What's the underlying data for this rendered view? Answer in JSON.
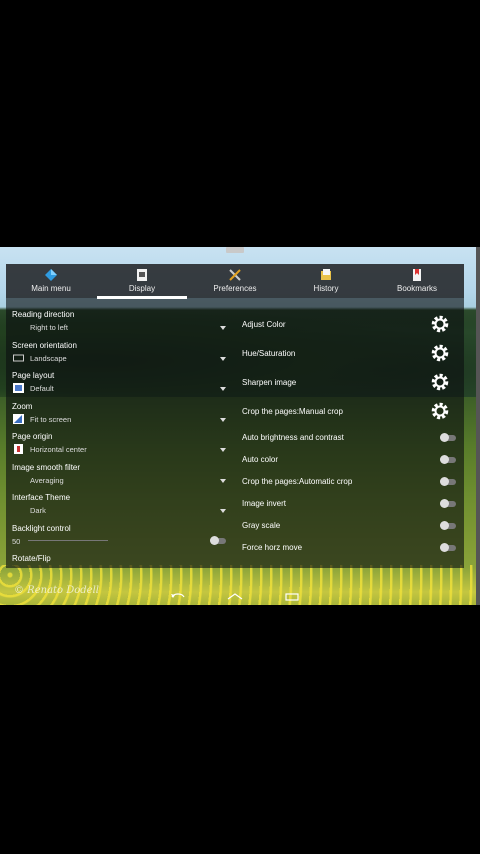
{
  "tabs": [
    {
      "label": "Main menu",
      "icon": "diamond-icon"
    },
    {
      "label": "Display",
      "icon": "display-icon"
    },
    {
      "label": "Preferences",
      "icon": "tools-icon"
    },
    {
      "label": "History",
      "icon": "history-icon"
    },
    {
      "label": "Bookmarks",
      "icon": "bookmark-icon"
    }
  ],
  "left_settings": {
    "reading_direction": {
      "title": "Reading direction",
      "value": "Right to left"
    },
    "screen_orientation": {
      "title": "Screen orientation",
      "value": "Landscape"
    },
    "page_layout": {
      "title": "Page layout",
      "value": "Default"
    },
    "zoom": {
      "title": "Zoom",
      "value": "Fit to screen"
    },
    "page_origin": {
      "title": "Page origin",
      "value": "Horizontal center"
    },
    "image_smooth": {
      "title": "Image smooth filter",
      "value": "Averaging"
    },
    "interface_theme": {
      "title": "Interface Theme",
      "value": "Dark"
    },
    "backlight": {
      "title": "Backlight control",
      "value": "50"
    },
    "rotate": {
      "title": "Rotate/Flip"
    }
  },
  "right_items": [
    {
      "label": "Adjust Color",
      "type": "gear"
    },
    {
      "label": "Hue/Saturation",
      "type": "gear"
    },
    {
      "label": "Sharpen image",
      "type": "gear"
    },
    {
      "label": "Crop the pages:Manual crop",
      "type": "gear"
    },
    {
      "label": "Auto brightness and contrast",
      "type": "toggle"
    },
    {
      "label": "Auto color",
      "type": "toggle"
    },
    {
      "label": "Crop the pages:Automatic crop",
      "type": "toggle"
    },
    {
      "label": "Image invert",
      "type": "toggle"
    },
    {
      "label": "Gray scale",
      "type": "toggle"
    },
    {
      "label": "Force horz move",
      "type": "toggle"
    }
  ],
  "watermark": "© Renato Dodell",
  "colors": {
    "panel": "#0c0e10",
    "accent": "#ffffff"
  }
}
